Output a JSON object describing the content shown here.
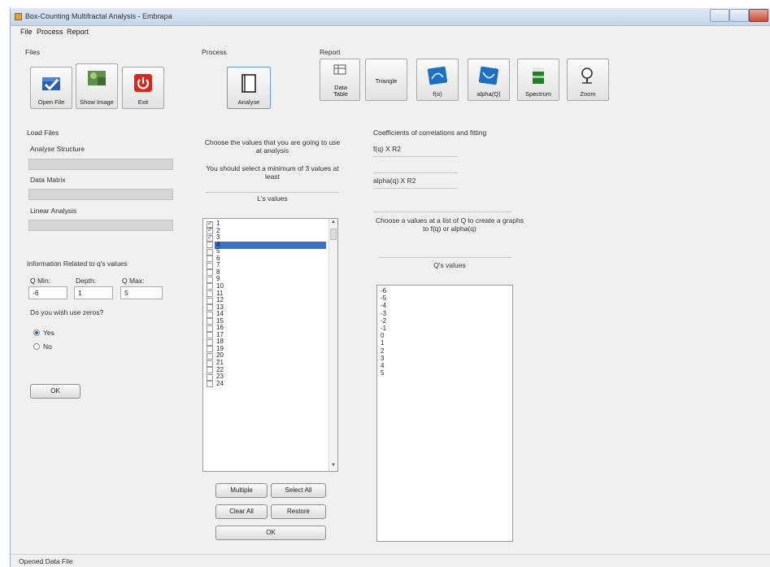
{
  "window": {
    "title": "Box-Counting Multifractal Analysis - Embrapa"
  },
  "menu": [
    "File",
    "Process",
    "Report"
  ],
  "groups": {
    "files": "Files",
    "process": "Process",
    "report": "Report"
  },
  "toolbar": {
    "files": [
      {
        "label": "Open File",
        "icon": "folder-check-icon"
      },
      {
        "label": "Show Image",
        "icon": "image-icon"
      },
      {
        "label": "Exit",
        "icon": "power-icon"
      }
    ],
    "process": [
      {
        "label": "Analyse",
        "icon": "book-icon"
      }
    ],
    "report": [
      {
        "label": "Data Table",
        "icon": "table-icon"
      },
      {
        "label": "Triangle",
        "icon": ""
      },
      {
        "label": "f(α)",
        "icon": "plot-icon"
      },
      {
        "label": "alpha(Q)",
        "icon": "plot-icon"
      },
      {
        "label": "Spectrum",
        "icon": "spectrum-icon"
      },
      {
        "label": "Zoom",
        "icon": "magnifier-icon"
      }
    ]
  },
  "load_files": {
    "title": "Load Files",
    "analyse_structure": "Analyse Structure",
    "data_matrix": "Data Matrix",
    "linear_analysis": "Linear Analysis"
  },
  "q_info": {
    "title": "Information Related to q's values",
    "qmin_label": "Q Min:",
    "depth_label": "Depth:",
    "qmax_label": "Q Max:",
    "qmin": "-6",
    "depth": "1",
    "qmax": "5",
    "zeros_question": "Do you wish use zeros?",
    "yes": "Yes",
    "no": "No",
    "yes_selected": true,
    "ok": "OK"
  },
  "l_panel": {
    "instruction1": "Choose the values that you are going to use at analysis",
    "instruction2": "You should select a minimum of 3 values at least",
    "header": "L's values",
    "items": [
      "1",
      "2",
      "3",
      "4",
      "5",
      "6",
      "7",
      "8",
      "9",
      "10",
      "11",
      "12",
      "13",
      "14",
      "15",
      "16",
      "17",
      "18",
      "19",
      "20",
      "21",
      "22",
      "23",
      "24"
    ],
    "checked": [
      true,
      true,
      true,
      false,
      false,
      false,
      false,
      false,
      false,
      false,
      false,
      false,
      false,
      false,
      false,
      false,
      false,
      false,
      false,
      false,
      false,
      false,
      false,
      false
    ],
    "selected_index": 3,
    "buttons": {
      "multiple": "Multiple",
      "select_all": "Select All",
      "clear_all": "Clear All",
      "restore": "Restore",
      "ok": "OK"
    }
  },
  "coef_panel": {
    "title": "Coefficients of correlations and fitting",
    "f_label": "f(q) X R2",
    "alpha_label": "alpha(q) X R2",
    "instruction": "Choose a values at a list of Q to create a graphs to f(q) or alpha(q)",
    "q_header": "Q's values",
    "q_items": [
      "-6",
      "-5",
      "-4",
      "-3",
      "-2",
      "-1",
      "0",
      "1",
      "2",
      "3",
      "4",
      "5"
    ]
  },
  "status": {
    "text": "Opened Data File"
  }
}
